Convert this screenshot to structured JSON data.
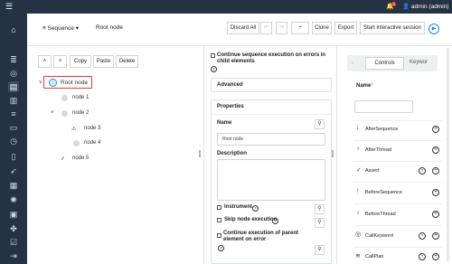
{
  "topbar": {
    "menu_icon": "menu-icon",
    "notification_count": "3",
    "user_label": "admin (admin)"
  },
  "sidebar": {
    "icons": [
      "home-icon",
      "layers-icon",
      "globe-icon",
      "document-icon",
      "file-icon",
      "list-icon",
      "page-icon",
      "clock-icon",
      "page-icon",
      "rocket-icon",
      "report-icon",
      "bug-icon",
      "chip-icon",
      "puzzle-icon",
      "check-icon",
      "logout-icon"
    ]
  },
  "header": {
    "view_select": "Sequence",
    "breadcrumb": "Root node",
    "toolbar": {
      "discard_all": "Discard All",
      "clone": "Clone",
      "export": "Export",
      "start_session": "Start interactive session"
    }
  },
  "tree_actions": {
    "up": "˄",
    "down": "˅",
    "copy": "Copy",
    "paste": "Paste",
    "delete": "Delete"
  },
  "tree": {
    "root": "Root node",
    "nodes": [
      {
        "label": "node 1"
      },
      {
        "label": "node 2"
      },
      {
        "label": "node 3"
      },
      {
        "label": "node 4"
      },
      {
        "label": "node 5"
      }
    ]
  },
  "props": {
    "continue_label": "Continue sequence execution on errors in child elements",
    "advanced": "Advanced",
    "properties": "Properties",
    "name_label": "Name",
    "name_value": "Root node",
    "description_label": "Description",
    "instrument": "Instrument",
    "skip": "Skip node execution",
    "continue_parent": "Continue execution of parent element on error"
  },
  "library": {
    "tab_controls": "Controls",
    "tab_keywords": "Keywor",
    "name_header": "Name",
    "sort_icon": "arrow-up-icon",
    "items": [
      {
        "label": "AfterSequence",
        "icon": "arrow-down-icon"
      },
      {
        "label": "AfterThread",
        "icon": "chevron-right-icon"
      },
      {
        "label": "Assert",
        "icon": "check-icon"
      },
      {
        "label": "BeforeSequence",
        "icon": "arrow-up-icon"
      },
      {
        "label": "BeforeThread",
        "icon": "chevron-left-icon"
      },
      {
        "label": "CallKeyword",
        "icon": "target-icon"
      },
      {
        "label": "CallPlan",
        "icon": "layers-icon"
      }
    ]
  },
  "colors": {
    "nav": "#243243",
    "accent": "#1e88e5",
    "highlight": "#e53935"
  }
}
